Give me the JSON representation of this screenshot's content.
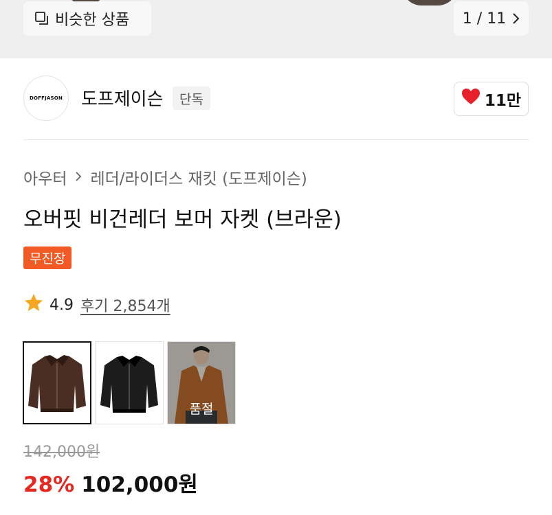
{
  "gallery": {
    "similar_label": "비슷한 상품",
    "page_indicator": "1 / 11",
    "icons": {
      "similar": "copy-icon",
      "next": "chevron-right-icon"
    }
  },
  "brand": {
    "logo_text": "DOFFJASON",
    "name": "도프제이슨",
    "badge": "단독",
    "like_count": "11만",
    "like_icon": "heart-icon",
    "like_color": "#e8202c"
  },
  "breadcrumb": {
    "category": "아우터",
    "subcategory": "레더/라이더스 재킷 (도프제이슨)",
    "separator_icon": "chevron-right-icon"
  },
  "product": {
    "title": "오버핏 비건레더 보머 자켓 (브라운)",
    "delivery_badge": "무진장",
    "delivery_badge_color": "#f15a24",
    "rating": "4.9",
    "review_text": "후기 2,854개",
    "star_color": "#f5a623"
  },
  "options": [
    {
      "name": "brown",
      "selected": true,
      "sold_out": false
    },
    {
      "name": "black",
      "selected": false,
      "sold_out": false
    },
    {
      "name": "camel",
      "selected": false,
      "sold_out": true,
      "sold_out_label": "품절"
    }
  ],
  "price": {
    "original": "142,000원",
    "discount": "28%",
    "sale": "102,000원",
    "discount_color": "#e6281f"
  }
}
